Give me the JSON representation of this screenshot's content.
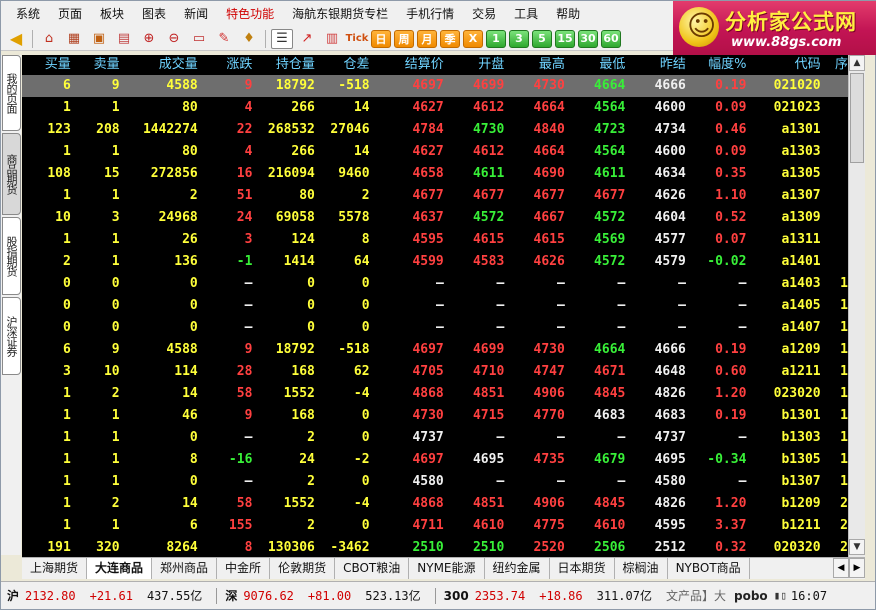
{
  "menu": [
    "系统",
    "页面",
    "板块",
    "图表",
    "新闻",
    "特色功能",
    "海航东银期货专栏",
    "手机行情",
    "交易",
    "工具",
    "帮助"
  ],
  "menu_active": "特色功能",
  "logo": {
    "text": "分析家公式网",
    "url": "www.88gs.com"
  },
  "toolbar": {
    "periods": [
      "日",
      "周",
      "月",
      "季",
      "X"
    ],
    "numbers": [
      "1",
      "3",
      "5",
      "15",
      "30",
      "60"
    ],
    "tick_label": "Tick"
  },
  "left_tabs": [
    "我的页面",
    "商品期货",
    "股指期货",
    "沪深证券"
  ],
  "columns": [
    "买量",
    "卖量",
    "成交量",
    "涨跌",
    "持仓量",
    "仓差",
    "结算价",
    "开盘",
    "最高",
    "最低",
    "昨结",
    "幅度%",
    "代码",
    "序"
  ],
  "rows": [
    {
      "buy": "6",
      "sell": "9",
      "vol": "4588",
      "chg": "9",
      "oi": "18792",
      "oichg": "-518",
      "settle": "4697",
      "open": "4699",
      "high": "4730",
      "low": "4664",
      "prev": "4666",
      "pct": "0.19",
      "code": "021020",
      "seq": "",
      "colors": [
        "red",
        "red",
        "red",
        "red",
        "green",
        "white",
        "red"
      ],
      "oichg_color": "white",
      "chg_color": "red"
    },
    {
      "buy": "1",
      "sell": "1",
      "vol": "80",
      "chg": "4",
      "oi": "266",
      "oichg": "14",
      "settle": "4627",
      "open": "4612",
      "high": "4664",
      "low": "4564",
      "prev": "4600",
      "pct": "0.09",
      "code": "021023",
      "seq": "",
      "colors": [
        "red",
        "red",
        "red",
        "green",
        "white",
        "red"
      ],
      "chg_color": "red"
    },
    {
      "buy": "123",
      "sell": "208",
      "vol": "1442274",
      "chg": "22",
      "oi": "268532",
      "oichg": "27046",
      "settle": "4784",
      "open": "4730",
      "high": "4840",
      "low": "4723",
      "prev": "4734",
      "pct": "0.46",
      "code": "a1301",
      "seq": "",
      "colors": [
        "red",
        "green",
        "red",
        "green",
        "white",
        "red"
      ],
      "chg_color": "red"
    },
    {
      "buy": "1",
      "sell": "1",
      "vol": "80",
      "chg": "4",
      "oi": "266",
      "oichg": "14",
      "settle": "4627",
      "open": "4612",
      "high": "4664",
      "low": "4564",
      "prev": "4600",
      "pct": "0.09",
      "code": "a1303",
      "seq": "",
      "colors": [
        "red",
        "red",
        "red",
        "green",
        "white",
        "red"
      ],
      "chg_color": "red"
    },
    {
      "buy": "108",
      "sell": "15",
      "vol": "272856",
      "chg": "16",
      "oi": "216094",
      "oichg": "9460",
      "settle": "4658",
      "open": "4611",
      "high": "4690",
      "low": "4611",
      "prev": "4634",
      "pct": "0.35",
      "code": "a1305",
      "seq": "",
      "colors": [
        "red",
        "green",
        "red",
        "green",
        "white",
        "red"
      ],
      "chg_color": "red"
    },
    {
      "buy": "1",
      "sell": "1",
      "vol": "2",
      "chg": "51",
      "oi": "80",
      "oichg": "2",
      "settle": "4677",
      "open": "4677",
      "high": "4677",
      "low": "4677",
      "prev": "4626",
      "pct": "1.10",
      "code": "a1307",
      "seq": "",
      "colors": [
        "red",
        "red",
        "red",
        "red",
        "white",
        "red"
      ],
      "chg_color": "red"
    },
    {
      "buy": "10",
      "sell": "3",
      "vol": "24968",
      "chg": "24",
      "oi": "69058",
      "oichg": "5578",
      "settle": "4637",
      "open": "4572",
      "high": "4667",
      "low": "4572",
      "prev": "4604",
      "pct": "0.52",
      "code": "a1309",
      "seq": "",
      "colors": [
        "red",
        "green",
        "red",
        "green",
        "white",
        "red"
      ],
      "chg_color": "red"
    },
    {
      "buy": "1",
      "sell": "1",
      "vol": "26",
      "chg": "3",
      "oi": "124",
      "oichg": "8",
      "settle": "4595",
      "open": "4615",
      "high": "4615",
      "low": "4569",
      "prev": "4577",
      "pct": "0.07",
      "code": "a1311",
      "seq": "",
      "colors": [
        "red",
        "red",
        "red",
        "green",
        "white",
        "red"
      ],
      "chg_color": "red"
    },
    {
      "buy": "2",
      "sell": "1",
      "vol": "136",
      "chg": "-1",
      "oi": "1414",
      "oichg": "64",
      "settle": "4599",
      "open": "4583",
      "high": "4626",
      "low": "4572",
      "prev": "4579",
      "pct": "-0.02",
      "code": "a1401",
      "seq": "",
      "colors": [
        "red",
        "red",
        "red",
        "green",
        "white",
        "green"
      ],
      "chg_color": "green"
    },
    {
      "buy": "0",
      "sell": "0",
      "vol": "0",
      "chg": "—",
      "oi": "0",
      "oichg": "0",
      "settle": "—",
      "open": "—",
      "high": "—",
      "low": "—",
      "prev": "—",
      "pct": "—",
      "code": "a1403",
      "seq": "1",
      "colors": [
        "dash",
        "dash",
        "dash",
        "dash",
        "dash",
        "dash"
      ],
      "chg_color": "dash"
    },
    {
      "buy": "0",
      "sell": "0",
      "vol": "0",
      "chg": "—",
      "oi": "0",
      "oichg": "0",
      "settle": "—",
      "open": "—",
      "high": "—",
      "low": "—",
      "prev": "—",
      "pct": "—",
      "code": "a1405",
      "seq": "1",
      "colors": [
        "dash",
        "dash",
        "dash",
        "dash",
        "dash",
        "dash"
      ],
      "chg_color": "dash"
    },
    {
      "buy": "0",
      "sell": "0",
      "vol": "0",
      "chg": "—",
      "oi": "0",
      "oichg": "0",
      "settle": "—",
      "open": "—",
      "high": "—",
      "low": "—",
      "prev": "—",
      "pct": "—",
      "code": "a1407",
      "seq": "1",
      "colors": [
        "dash",
        "dash",
        "dash",
        "dash",
        "dash",
        "dash"
      ],
      "chg_color": "dash"
    },
    {
      "buy": "6",
      "sell": "9",
      "vol": "4588",
      "chg": "9",
      "oi": "18792",
      "oichg": "-518",
      "settle": "4697",
      "open": "4699",
      "high": "4730",
      "low": "4664",
      "prev": "4666",
      "pct": "0.19",
      "code": "a1209",
      "seq": "1",
      "colors": [
        "red",
        "red",
        "red",
        "green",
        "white",
        "red"
      ],
      "chg_color": "red"
    },
    {
      "buy": "3",
      "sell": "10",
      "vol": "114",
      "chg": "28",
      "oi": "168",
      "oichg": "62",
      "settle": "4705",
      "open": "4710",
      "high": "4747",
      "low": "4671",
      "prev": "4648",
      "pct": "0.60",
      "code": "a1211",
      "seq": "1",
      "colors": [
        "red",
        "red",
        "red",
        "red",
        "white",
        "red"
      ],
      "chg_color": "red"
    },
    {
      "buy": "1",
      "sell": "2",
      "vol": "14",
      "chg": "58",
      "oi": "1552",
      "oichg": "-4",
      "settle": "4868",
      "open": "4851",
      "high": "4906",
      "low": "4845",
      "prev": "4826",
      "pct": "1.20",
      "code": "023020",
      "seq": "1",
      "colors": [
        "red",
        "red",
        "red",
        "red",
        "white",
        "red"
      ],
      "chg_color": "red"
    },
    {
      "buy": "1",
      "sell": "1",
      "vol": "46",
      "chg": "9",
      "oi": "168",
      "oichg": "0",
      "settle": "4730",
      "open": "4715",
      "high": "4770",
      "low": "4683",
      "prev": "4683",
      "pct": "0.19",
      "code": "b1301",
      "seq": "1",
      "colors": [
        "red",
        "red",
        "red",
        "white",
        "white",
        "red"
      ],
      "chg_color": "red"
    },
    {
      "buy": "1",
      "sell": "1",
      "vol": "0",
      "chg": "—",
      "oi": "2",
      "oichg": "0",
      "settle": "4737",
      "open": "—",
      "high": "—",
      "low": "—",
      "prev": "4737",
      "pct": "—",
      "code": "b1303",
      "seq": "1",
      "colors": [
        "white",
        "dash",
        "dash",
        "dash",
        "white",
        "dash"
      ],
      "chg_color": "dash"
    },
    {
      "buy": "1",
      "sell": "1",
      "vol": "8",
      "chg": "-16",
      "oi": "24",
      "oichg": "-2",
      "settle": "4697",
      "open": "4695",
      "high": "4735",
      "low": "4679",
      "prev": "4695",
      "pct": "-0.34",
      "code": "b1305",
      "seq": "1",
      "colors": [
        "red",
        "white",
        "red",
        "green",
        "white",
        "green"
      ],
      "chg_color": "green"
    },
    {
      "buy": "1",
      "sell": "1",
      "vol": "0",
      "chg": "—",
      "oi": "2",
      "oichg": "0",
      "settle": "4580",
      "open": "—",
      "high": "—",
      "low": "—",
      "prev": "4580",
      "pct": "—",
      "code": "b1307",
      "seq": "1",
      "colors": [
        "white",
        "dash",
        "dash",
        "dash",
        "white",
        "dash"
      ],
      "chg_color": "dash"
    },
    {
      "buy": "1",
      "sell": "2",
      "vol": "14",
      "chg": "58",
      "oi": "1552",
      "oichg": "-4",
      "settle": "4868",
      "open": "4851",
      "high": "4906",
      "low": "4845",
      "prev": "4826",
      "pct": "1.20",
      "code": "b1209",
      "seq": "2",
      "colors": [
        "red",
        "red",
        "red",
        "red",
        "white",
        "red"
      ],
      "chg_color": "red"
    },
    {
      "buy": "1",
      "sell": "1",
      "vol": "6",
      "chg": "155",
      "oi": "2",
      "oichg": "0",
      "settle": "4711",
      "open": "4610",
      "high": "4775",
      "low": "4610",
      "prev": "4595",
      "pct": "3.37",
      "code": "b1211",
      "seq": "2",
      "colors": [
        "red",
        "red",
        "red",
        "red",
        "white",
        "red"
      ],
      "chg_color": "red"
    },
    {
      "buy": "191",
      "sell": "320",
      "vol": "8264",
      "chg": "8",
      "oi": "130306",
      "oichg": "-3462",
      "settle": "2510",
      "open": "2510",
      "high": "2520",
      "low": "2506",
      "prev": "2512",
      "pct": "0.32",
      "code": "020320",
      "seq": "2",
      "colors": [
        "green",
        "green",
        "red",
        "green",
        "white",
        "red"
      ],
      "chg_color": "red"
    }
  ],
  "bottom_tabs": [
    "上海期货",
    "大连商品",
    "郑州商品",
    "中金所",
    "伦敦期货",
    "CBOT粮油",
    "NYME能源",
    "纽约金属",
    "日本期货",
    "棕榈油",
    "NYBOT商品"
  ],
  "bottom_active": "大连商品",
  "status": {
    "sh_label": "沪",
    "sh_price": "2132.80",
    "sh_chg": "+21.61",
    "sh_amt": "437.55亿",
    "sz_label": "深",
    "sz_price": "9076.62",
    "sz_chg": "+81.00",
    "sz_amt": "523.13亿",
    "i300_label": "300",
    "i300_price": "2353.74",
    "i300_chg": "+18.86",
    "i300_amt": "311.07亿",
    "product": "文产品】大",
    "brand": "pobo",
    "time": "16:07"
  },
  "colors": {
    "accent_red": "#ff4040",
    "accent_green": "#38f038",
    "header_cyan": "#6fd3ff",
    "yellow": "#ffff3a"
  }
}
